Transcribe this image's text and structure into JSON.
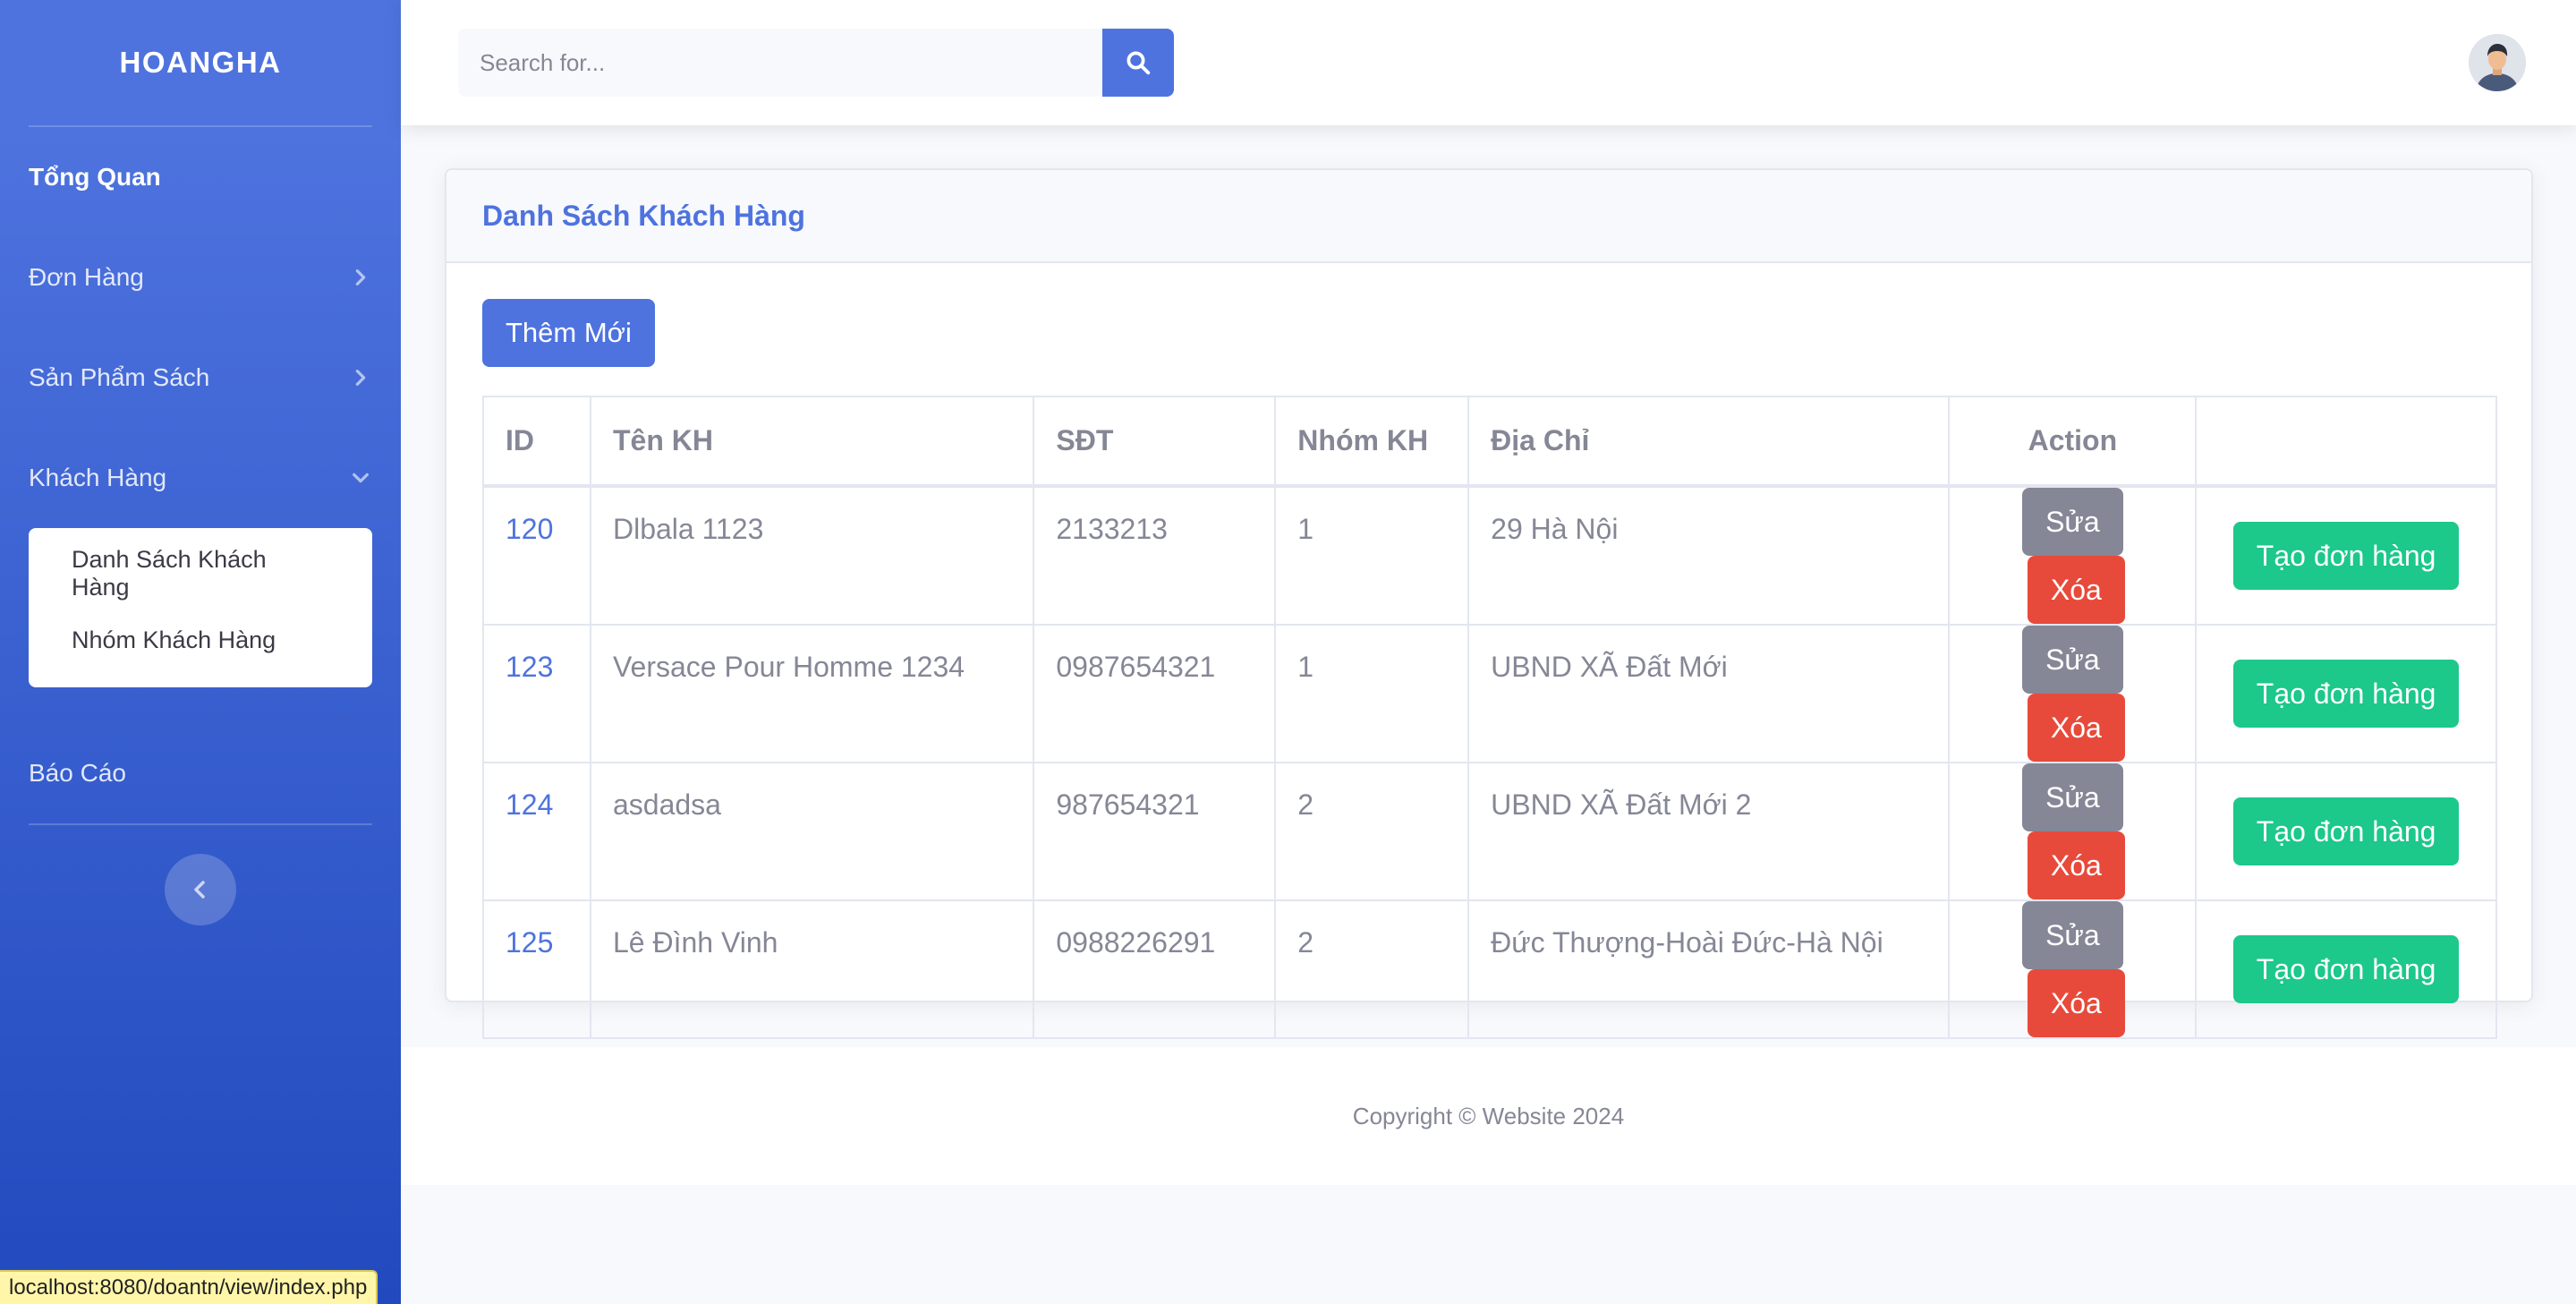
{
  "sidebar": {
    "brand": "HOANGHA",
    "items": [
      {
        "label": "Tổng Quan"
      },
      {
        "label": "Đơn Hàng"
      },
      {
        "label": "Sản Phẩm Sách"
      },
      {
        "label": "Khách Hàng"
      },
      {
        "label": "Báo Cáo"
      }
    ],
    "submenu": [
      {
        "label": "Danh Sách Khách Hàng"
      },
      {
        "label": "Nhóm Khách Hàng"
      }
    ]
  },
  "search": {
    "placeholder": "Search for..."
  },
  "card": {
    "title": "Danh Sách Khách Hàng",
    "add_label": "Thêm Mới"
  },
  "table": {
    "headers": [
      "ID",
      "Tên KH",
      "SĐT",
      "Nhóm KH",
      "Địa Chỉ",
      "Action",
      ""
    ],
    "rows": [
      {
        "id": "120",
        "name": "Dlbala 1123",
        "phone": "2133213",
        "group": "1",
        "address": "29 Hà Nội"
      },
      {
        "id": "123",
        "name": "Versace Pour Homme 1234",
        "phone": "0987654321",
        "group": "1",
        "address": "UBND XÃ Đất Mới"
      },
      {
        "id": "124",
        "name": "asdadsa",
        "phone": "987654321",
        "group": "2",
        "address": "UBND XÃ Đất Mới 2"
      },
      {
        "id": "125",
        "name": "Lê Đình Vinh",
        "phone": "0988226291",
        "group": "2",
        "address": "Đức Thượng-Hoài Đức-Hà Nội"
      }
    ],
    "edit_label": "Sửa",
    "delete_label": "Xóa",
    "create_order_label": "Tạo đơn hàng"
  },
  "footer": {
    "text": "Copyright © Website 2024"
  },
  "status_url": "localhost:8080/doantn/view/index.php",
  "colors": {
    "primary": "#4e73df",
    "danger": "#e74a3b",
    "success": "#1cc88a",
    "secondary": "#858796"
  }
}
